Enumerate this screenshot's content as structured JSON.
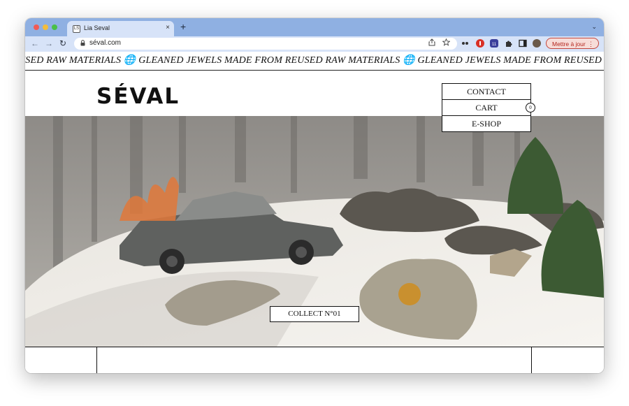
{
  "browser": {
    "tab_title": "Lia Seval",
    "tab_close": "×",
    "new_tab": "+",
    "tab_menu": "⌄",
    "favicon": "LS",
    "url": "séval.com",
    "update_button": "Mettre à jour",
    "update_menu": "⋮",
    "extension_badge": "11",
    "nav": {
      "back": "←",
      "forward": "→",
      "reload": "↻"
    },
    "lock": "🔒"
  },
  "site": {
    "marquee": "USED RAW MATERIALS 🌐 GLEANED JEWELS MADE FROM REUSED RAW MATERIALS 🌐 GLEANED JEWELS MADE FROM REUSED RAW MATERIALS",
    "logo": "SÉVAL",
    "menu": {
      "contact": "CONTACT",
      "cart": "CART",
      "cart_count": "0",
      "eshop": "E-SHOP"
    },
    "hero_cta": "COLLECT N°01"
  },
  "colors": {
    "tab_strip": "#8fb0e2",
    "toolbar": "#d7e3f8",
    "update_border": "#c4463c",
    "accent_text": "#111111"
  }
}
